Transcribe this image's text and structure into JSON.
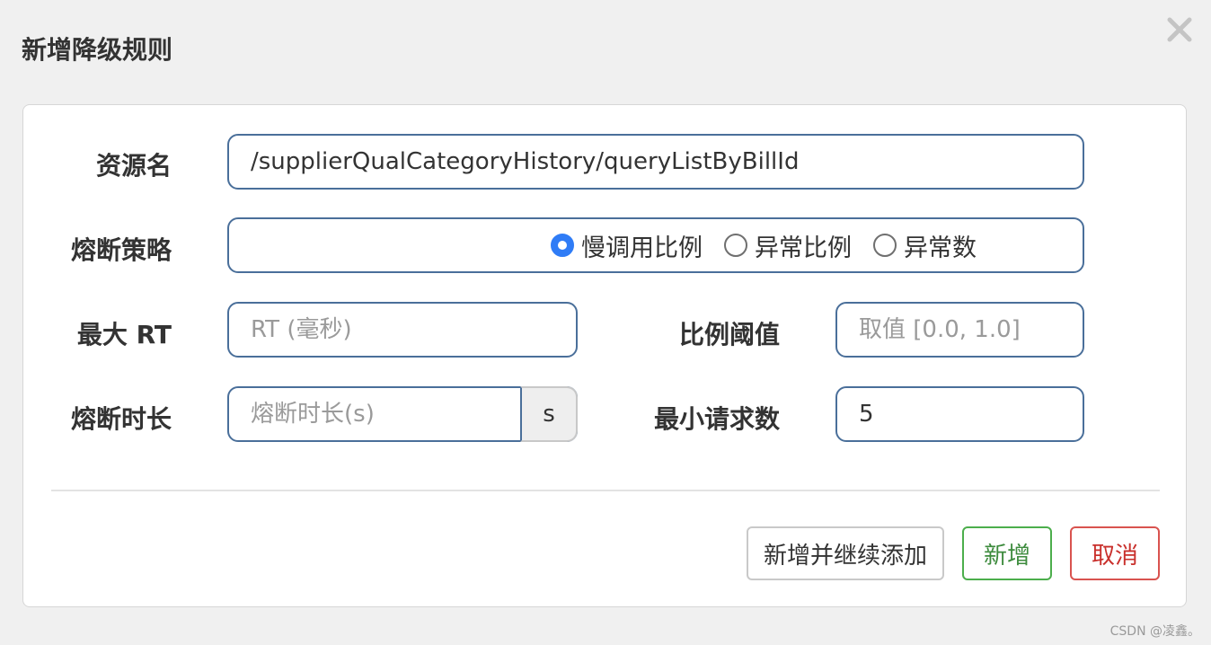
{
  "dialog": {
    "title": "新增降级规则"
  },
  "form": {
    "resource": {
      "label": "资源名",
      "value": "/supplierQualCategoryHistory/queryListByBillId"
    },
    "strategy": {
      "label": "熔断策略",
      "options": [
        "慢调用比例",
        "异常比例",
        "异常数"
      ],
      "selected": "慢调用比例"
    },
    "max_rt": {
      "label": "最大 RT",
      "placeholder": "RT (毫秒)",
      "value": ""
    },
    "ratio_threshold": {
      "label": "比例阈值",
      "placeholder": "取值 [0.0, 1.0]",
      "value": ""
    },
    "break_duration": {
      "label": "熔断时长",
      "placeholder": "熔断时长(s)",
      "value": "",
      "unit": "s"
    },
    "min_requests": {
      "label": "最小请求数",
      "value": "5"
    }
  },
  "buttons": {
    "add_continue": "新增并继续添加",
    "add": "新增",
    "cancel": "取消"
  },
  "watermark": "CSDN @凌鑫。",
  "colors": {
    "field_border": "#4a6f9a",
    "radio_checked": "#2f7cf6",
    "btn_add": "#4cae4c",
    "btn_cancel": "#d9534f"
  }
}
